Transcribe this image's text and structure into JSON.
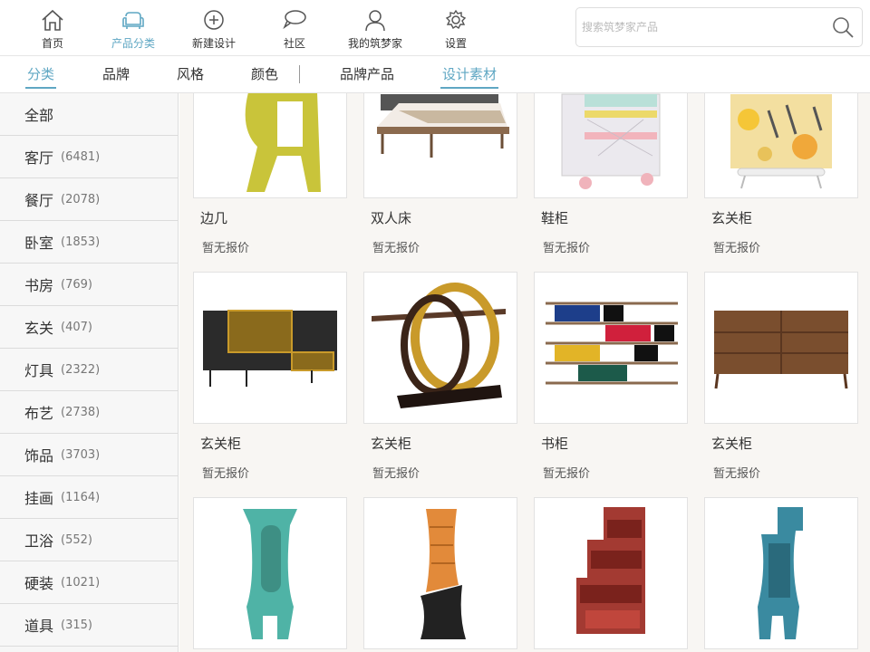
{
  "nav": {
    "items": [
      {
        "label": "首页",
        "icon": "home-icon"
      },
      {
        "label": "产品分类",
        "icon": "sofa-icon",
        "active": true
      },
      {
        "label": "新建设计",
        "icon": "plus-circle-icon"
      },
      {
        "label": "社区",
        "icon": "chat-bubbles-icon"
      },
      {
        "label": "我的筑梦家",
        "icon": "user-icon"
      },
      {
        "label": "设置",
        "icon": "gear-icon"
      }
    ],
    "search_placeholder": "搜索筑梦家产品",
    "accent": "#5fa7c3"
  },
  "tabs": {
    "left": [
      "分类",
      "品牌",
      "风格",
      "颜色"
    ],
    "right": [
      "品牌产品",
      "设计素材"
    ]
  },
  "sidebar": {
    "items": [
      {
        "name": "全部",
        "count": ""
      },
      {
        "name": "客厅",
        "count": "(6481)"
      },
      {
        "name": "餐厅",
        "count": "(2078)"
      },
      {
        "name": "卧室",
        "count": "(1853)"
      },
      {
        "name": "书房",
        "count": "(769)"
      },
      {
        "name": "玄关",
        "count": "(407)"
      },
      {
        "name": "灯具",
        "count": "(2322)"
      },
      {
        "name": "布艺",
        "count": "(2738)"
      },
      {
        "name": "饰品",
        "count": "(3703)"
      },
      {
        "name": "挂画",
        "count": "(1164)"
      },
      {
        "name": "卫浴",
        "count": "(552)"
      },
      {
        "name": "硬装",
        "count": "(1021)"
      },
      {
        "name": "道具",
        "count": "(315)"
      }
    ]
  },
  "products": [
    {
      "name": "边几",
      "price": "暂无报价",
      "image": "yellow-side-table"
    },
    {
      "name": "双人床",
      "price": "暂无报价",
      "image": "double-bed"
    },
    {
      "name": "鞋柜",
      "price": "暂无报价",
      "image": "shoe-cabinet"
    },
    {
      "name": "玄关柜",
      "price": "暂无报价",
      "image": "floral-cabinet"
    },
    {
      "name": "玄关柜",
      "price": "暂无报价",
      "image": "dark-console-cabinet"
    },
    {
      "name": "玄关柜",
      "price": "暂无报价",
      "image": "ring-console-table"
    },
    {
      "name": "书柜",
      "price": "暂无报价",
      "image": "color-block-bookshelf"
    },
    {
      "name": "玄关柜",
      "price": "暂无报价",
      "image": "walnut-dresser"
    },
    {
      "name": "",
      "price": "",
      "image": "teal-curved-cabinet"
    },
    {
      "name": "",
      "price": "",
      "image": "orange-curved-shelf"
    },
    {
      "name": "",
      "price": "",
      "image": "red-stepped-shelf"
    },
    {
      "name": "",
      "price": "",
      "image": "blue-curved-shelf"
    }
  ]
}
